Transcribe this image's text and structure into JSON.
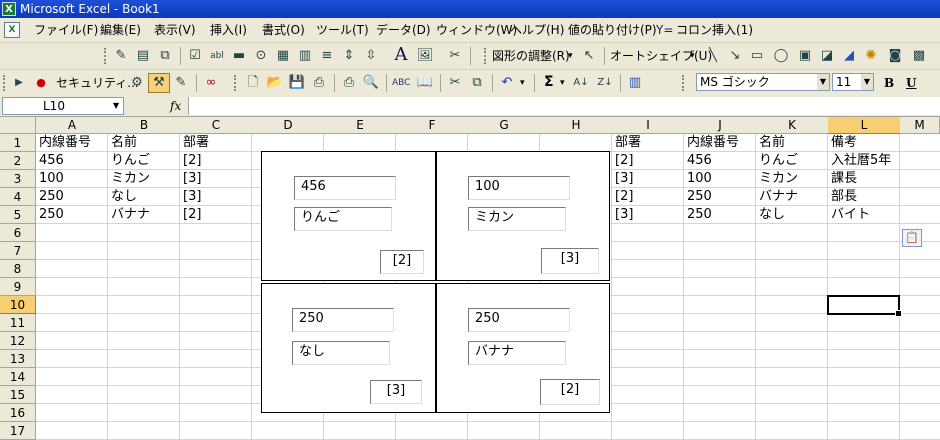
{
  "window": {
    "app_icon": "excel-icon",
    "title": "Microsoft Excel - Book1"
  },
  "menubar": {
    "items": [
      "ファイル(F)",
      "編集(E)",
      "表示(V)",
      "挿入(I)",
      "書式(O)",
      "ツール(T)",
      "データ(D)",
      "ウィンドウ(W)",
      "ヘルプ(H)",
      "値の貼り付け(P)",
      "コロン挿入(1)"
    ]
  },
  "toolbar_forms": {
    "draw_adjust_label": "図形の調整(R)",
    "autoshape_label": "オートシェイプ(U)"
  },
  "toolbar_standard": {
    "macro_security_label": "セキュリティ...",
    "sum_label": "Σ",
    "font_name": "MS ゴシック",
    "font_size": "11",
    "bold_label": "B",
    "underline_label": "U"
  },
  "formula_bar": {
    "name_box": "L10",
    "fx_label": "fx",
    "formula": ""
  },
  "grid": {
    "columns": [
      "A",
      "B",
      "C",
      "D",
      "E",
      "F",
      "G",
      "H",
      "I",
      "J",
      "K",
      "L",
      "M"
    ],
    "rows": [
      "1",
      "2",
      "3",
      "4",
      "5",
      "6",
      "7",
      "8",
      "9",
      "10",
      "11",
      "12",
      "13",
      "14",
      "15",
      "16",
      "17"
    ],
    "selected_cell": "L10",
    "left_table": [
      [
        "内線番号",
        "名前",
        "部署"
      ],
      [
        "456",
        "りんご",
        "[2]"
      ],
      [
        "100",
        "ミカン",
        "[3]"
      ],
      [
        "250",
        "なし",
        "[3]"
      ],
      [
        "250",
        "バナナ",
        "[2]"
      ]
    ],
    "right_table": [
      [
        "部署",
        "内線番号",
        "名前",
        "備考"
      ],
      [
        "[2]",
        "456",
        "りんご",
        "入社暦5年"
      ],
      [
        "[3]",
        "100",
        "ミカン",
        "課長"
      ],
      [
        "[2]",
        "250",
        "バナナ",
        "部長"
      ],
      [
        "[3]",
        "250",
        "なし",
        "バイト"
      ]
    ]
  },
  "cards": [
    {
      "number": "456",
      "name": "りんご",
      "dept": "[2]"
    },
    {
      "number": "100",
      "name": "ミカン",
      "dept": "[3]"
    },
    {
      "number": "250",
      "name": "なし",
      "dept": "[3]"
    },
    {
      "number": "250",
      "name": "バナナ",
      "dept": "[2]"
    }
  ],
  "colors": {
    "selection_header": "#f7cf72",
    "title_bar": "#0a3ab8",
    "chrome": "#ece9d8"
  }
}
